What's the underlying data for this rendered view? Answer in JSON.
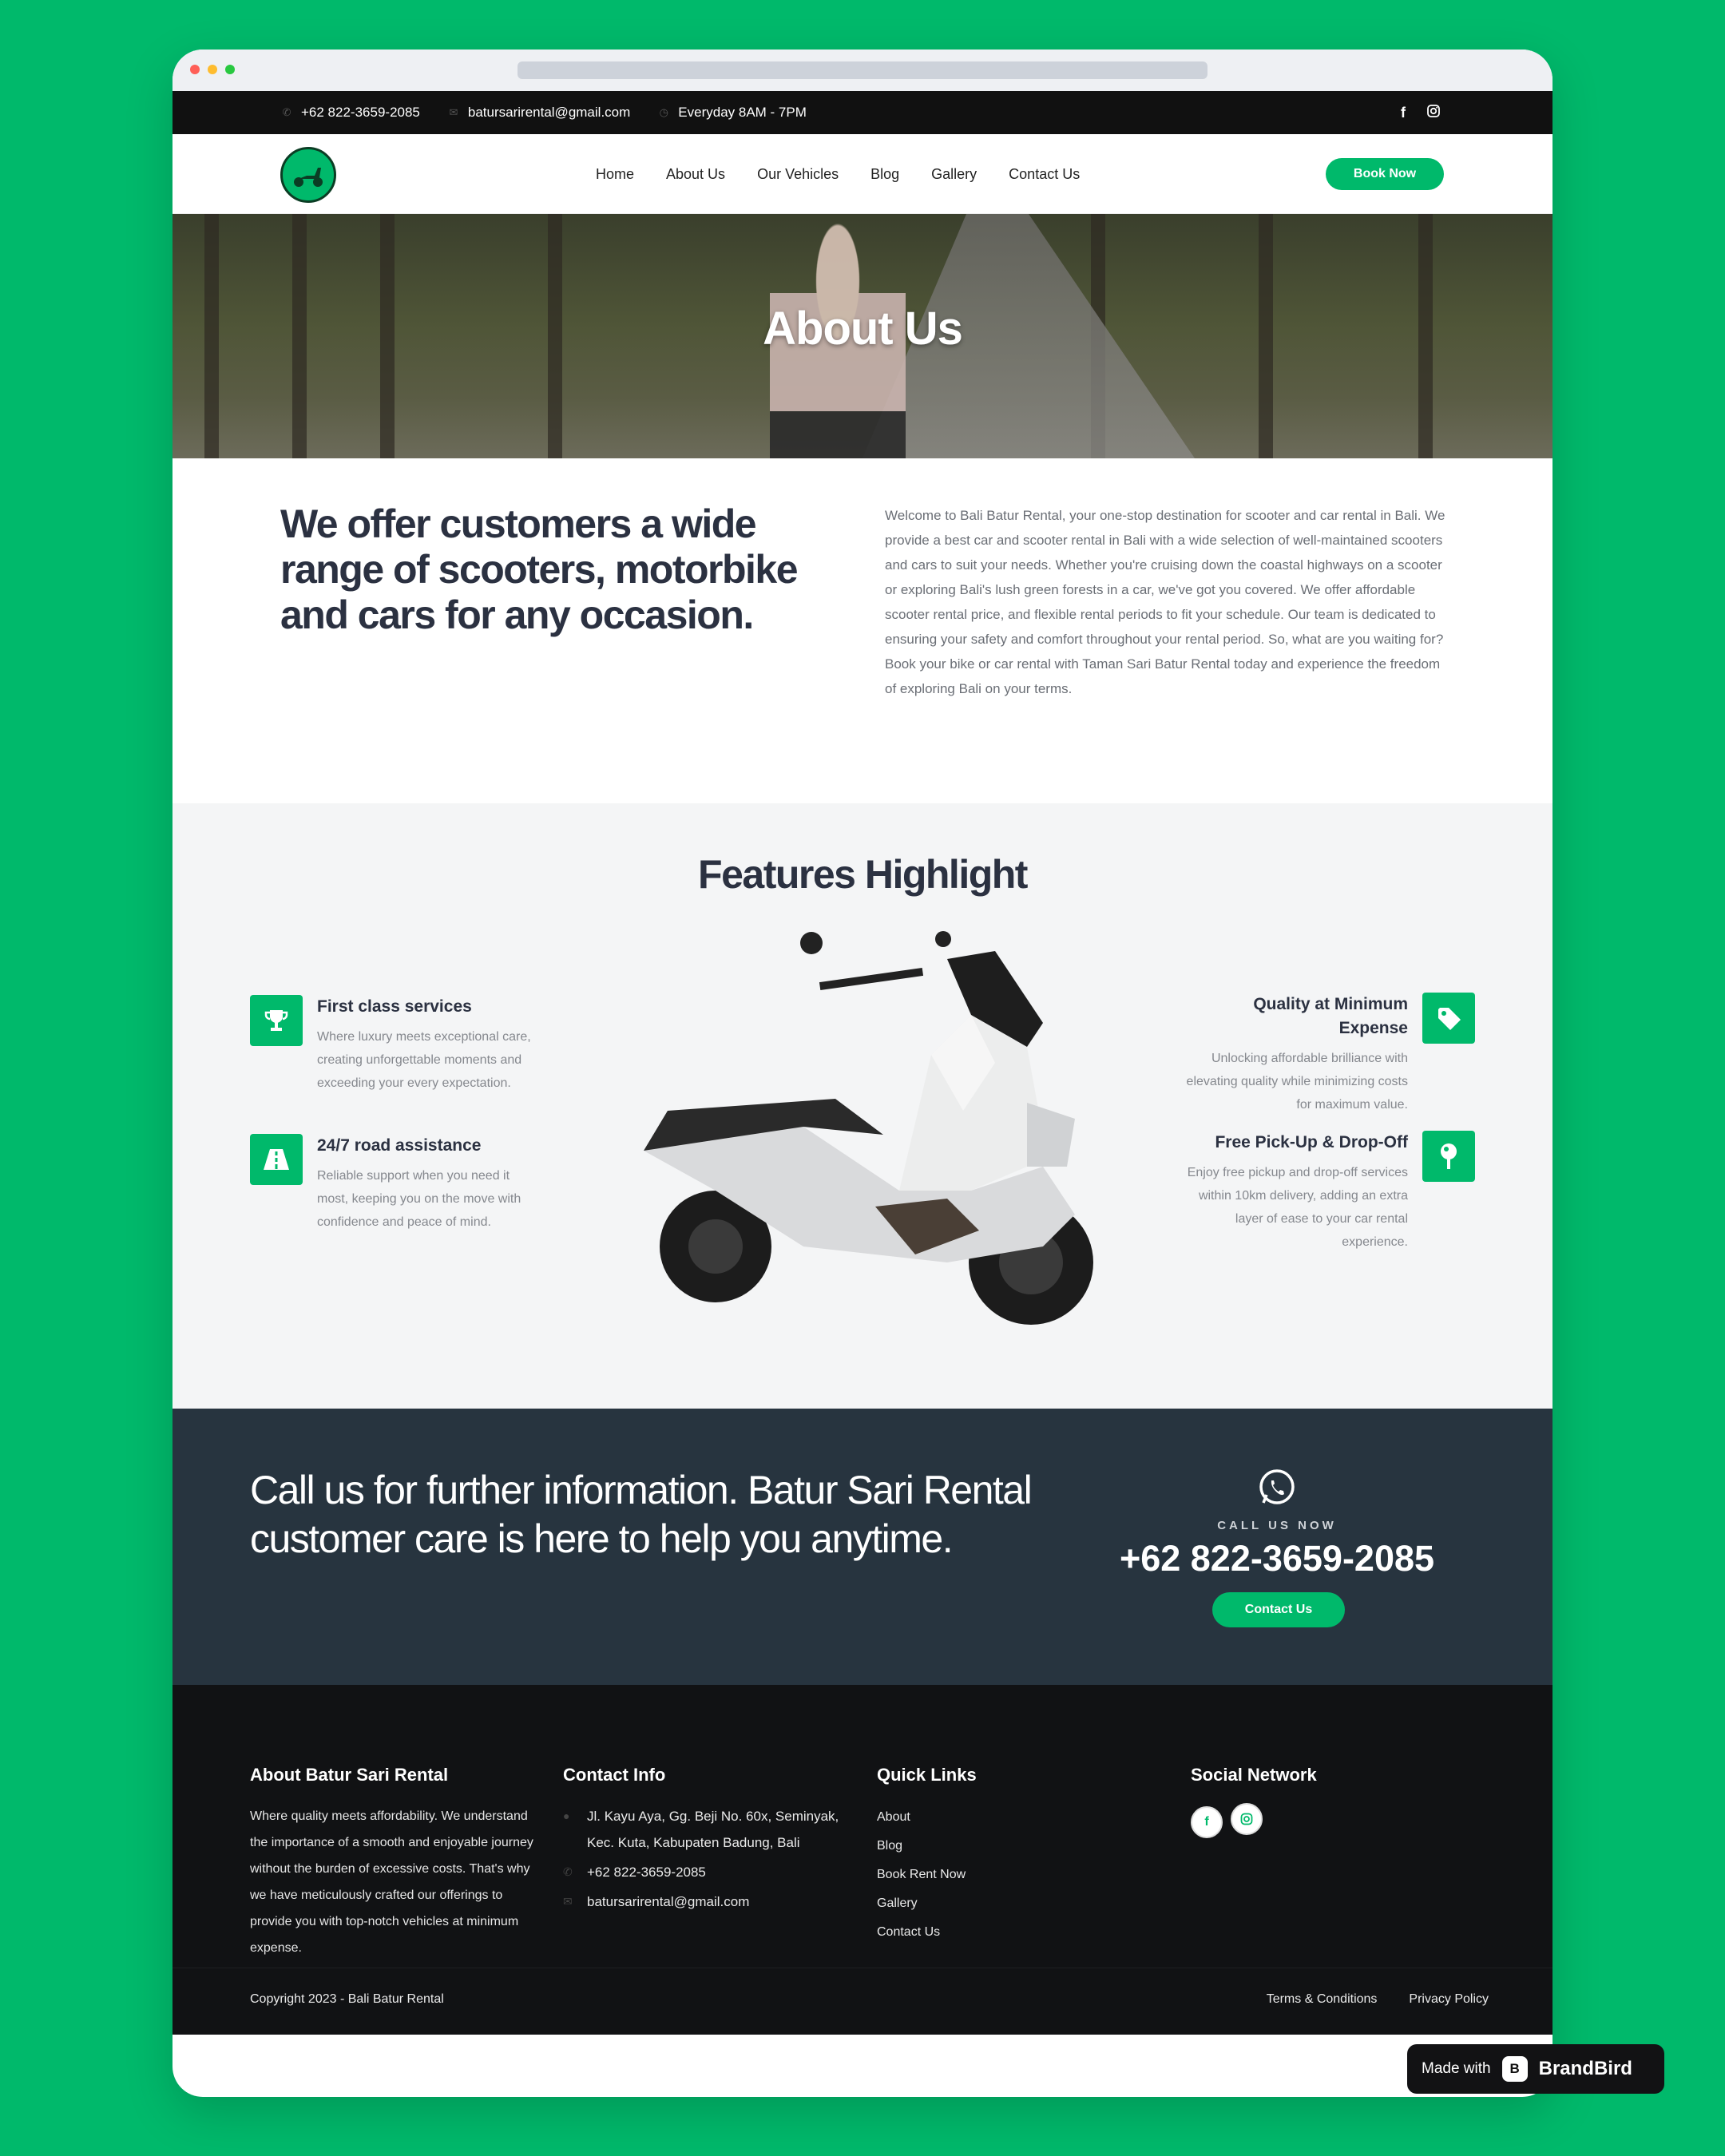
{
  "topbar": {
    "phone": "+62 822-3659-2085",
    "email": "batursarirental@gmail.com",
    "hours": "Everyday 8AM - 7PM",
    "social": [
      "facebook-icon",
      "instagram-icon"
    ]
  },
  "nav": {
    "items": [
      "Home",
      "About Us",
      "Our Vehicles",
      "Blog",
      "Gallery",
      "Contact Us"
    ],
    "cta": "Book Now"
  },
  "hero": {
    "title": "About Us"
  },
  "about": {
    "heading": "We offer customers a wide range of scooters, motorbike and cars for any occasion.",
    "body": "Welcome to Bali Batur Rental, your one-stop destination for scooter and car rental in Bali. We provide a best car and scooter rental in Bali with a wide selection of well-maintained scooters and cars to suit your needs. Whether you're cruising down the coastal highways on a scooter or exploring Bali's lush green forests in a car, we've got you covered. We offer affordable scooter rental price, and flexible rental periods to fit your schedule. Our team is dedicated to ensuring your safety and comfort throughout your rental period. So, what are you waiting for? Book your bike or car rental with Taman Sari Batur Rental today and experience the freedom of exploring Bali on your terms."
  },
  "features": {
    "title": "Features Highlight",
    "left": [
      {
        "title": "First class services",
        "text": "Where luxury meets exceptional care, creating unforgettable moments and exceeding your every expectation.",
        "icon": "trophy-icon"
      },
      {
        "title": "24/7 road assistance",
        "text": "Reliable support when you need it most, keeping you on the move with confidence and peace of mind.",
        "icon": "road-icon"
      }
    ],
    "right": [
      {
        "title": "Quality at Minimum Expense",
        "text": "Unlocking affordable brilliance with elevating quality while minimizing costs for maximum value.",
        "icon": "tag-icon"
      },
      {
        "title": "Free Pick-Up & Drop-Off",
        "text": "Enjoy free pickup and drop-off services within 10km delivery, adding an extra layer of ease to your car rental experience.",
        "icon": "map-pin-icon"
      }
    ]
  },
  "cta": {
    "heading": "Call us for further information. Batur Sari Rental customer care is here to help you anytime.",
    "call_label": "CALL US NOW",
    "phone": "+62 822-3659-2085",
    "button": "Contact Us"
  },
  "footer": {
    "about_title": "About Batur Sari Rental",
    "about_text": "Where quality meets affordability. We understand the importance of a smooth and enjoyable journey without the burden of excessive costs. That's why we have meticulously crafted our offerings to provide you with top-notch vehicles at minimum expense.",
    "contact_title": "Contact Info",
    "address": "Jl. Kayu Aya, Gg. Beji No. 60x, Seminyak, Kec. Kuta, Kabupaten Badung, Bali",
    "phone": "+62 822-3659-2085",
    "email": "batursarirental@gmail.com",
    "links_title": "Quick Links",
    "links": [
      "About",
      "Blog",
      "Book Rent Now",
      "Gallery",
      "Contact Us"
    ],
    "social_title": "Social Network",
    "copyright": "Copyright 2023 - Bali Batur Rental",
    "terms": "Terms & Conditions",
    "privacy": "Privacy Policy"
  },
  "badge": {
    "made_with": "Made with",
    "brand": "BrandBird"
  },
  "colors": {
    "accent": "#00b96b",
    "dark": "#27343f",
    "footer": "#111214"
  }
}
